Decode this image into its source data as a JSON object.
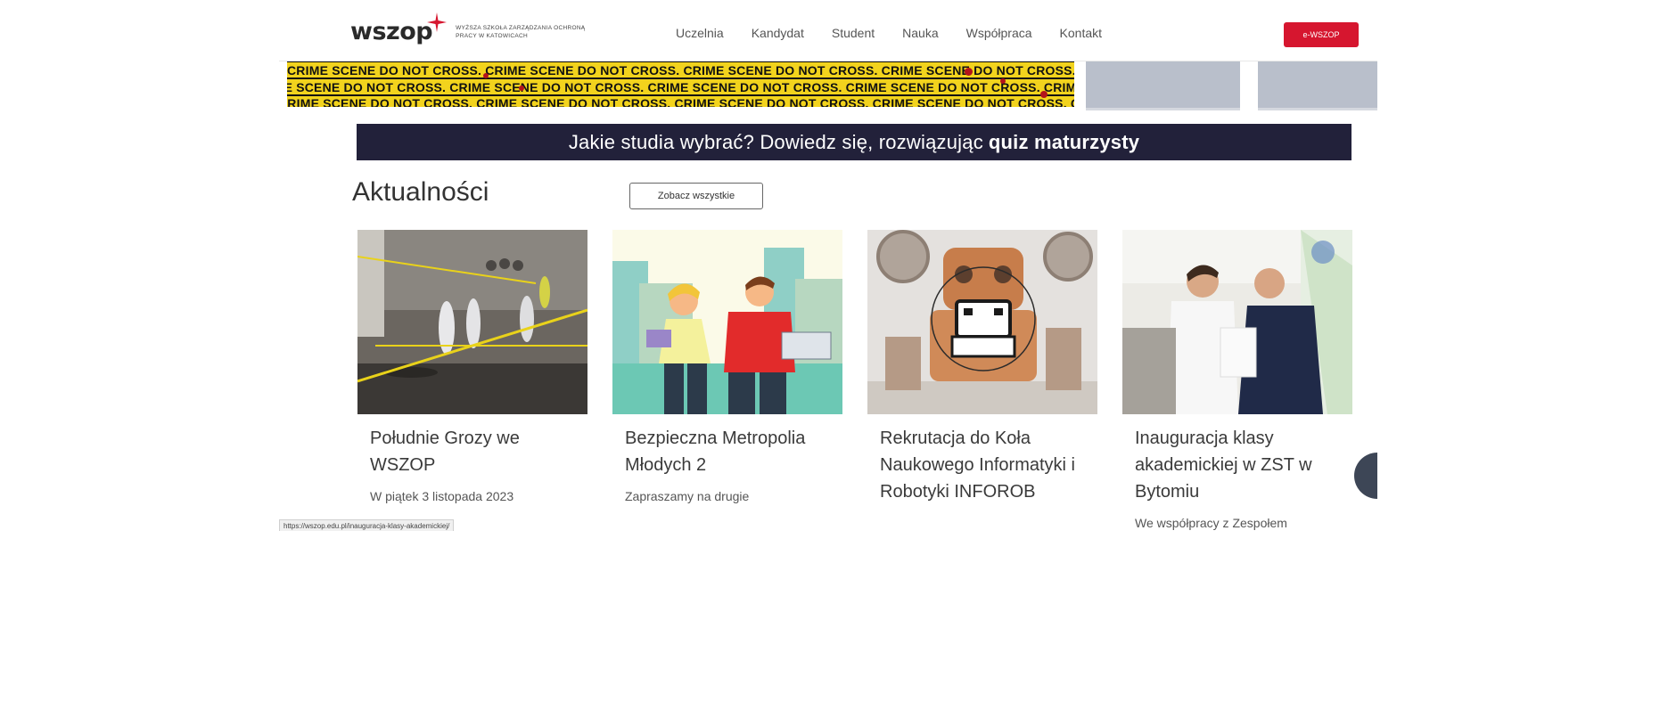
{
  "header": {
    "logo_text": "wszop",
    "logo_subtitle": "WYŻSZA SZKOŁA ZARZĄDZANIA OCHRONĄ PRACY W KATOWICACH",
    "nav": [
      "Uczelnia",
      "Kandydat",
      "Student",
      "Nauka",
      "Współpraca",
      "Kontakt"
    ],
    "cta_label": "e-WSZOP",
    "brand_red": "#d6162f"
  },
  "hero": {
    "tape_text": "CRIME SCENE DO NOT CROSS",
    "tape_color": "#f2d31d"
  },
  "quiz_banner": {
    "text": "Jakie studia wybrać? Dowiedz się, rozwiązując",
    "bold": "quiz maturzysty",
    "bg": "#22213a"
  },
  "news": {
    "title": "Aktualności",
    "see_all": "Zobacz wszystkie",
    "items": [
      {
        "title": "Południe Grozy we WSZOP",
        "desc": "W piątek 3 listopada 2023",
        "image": "crime-scene-photo"
      },
      {
        "title": "Bezpieczna Metropolia Młodych 2",
        "desc": "Zapraszamy na drugie",
        "image": "students-illustration"
      },
      {
        "title": "Rekrutacja do Koła Naukowego Informatyki i Robotyki INFOROB",
        "desc": "",
        "image": "robot-illustration"
      },
      {
        "title": "Inauguracja klasy akademickiej w ZST w Bytomiu",
        "desc": "We współpracy z Zespołem",
        "image": "ceremony-photo"
      }
    ]
  },
  "status": {
    "url": "https://wszop.edu.pl/inauguracja-klasy-akademickiej/"
  }
}
